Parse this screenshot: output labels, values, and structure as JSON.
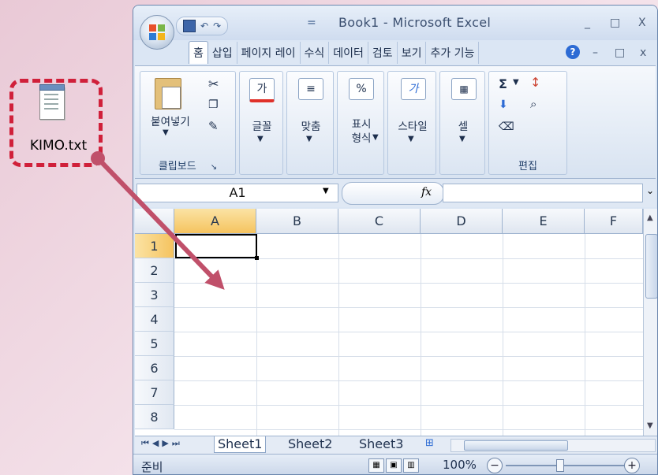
{
  "desktop": {
    "file_name": "KIMO.txt"
  },
  "window": {
    "title": "Book1 - Microsoft Excel",
    "controls": [
      "_",
      "□",
      "X"
    ]
  },
  "quick_access": {
    "undo": "↶",
    "redo": "↷",
    "more": "="
  },
  "ribbon": {
    "tabs": [
      "홈",
      "삽입",
      "페이지 레이",
      "수식",
      "데이터",
      "검토",
      "보기",
      "추가 기능"
    ],
    "groups": {
      "clipboard": {
        "label": "클립보드",
        "paste": "붙여넣기"
      },
      "font": {
        "label": "글꼴",
        "icon_text": "가"
      },
      "alignment": {
        "label": "맞춤"
      },
      "number": {
        "label": "표시\n형식",
        "icon_text": "%"
      },
      "styles": {
        "label": "스타일",
        "icon_text": "가"
      },
      "cells": {
        "label": "셀"
      },
      "editing": {
        "label": "편집",
        "sigma": "Σ"
      }
    }
  },
  "formula_bar": {
    "name_box": "A1",
    "fx": "fx",
    "value": ""
  },
  "sheet": {
    "columns": [
      "A",
      "B",
      "C",
      "D",
      "E",
      "F"
    ],
    "rows": [
      "1",
      "2",
      "3",
      "4",
      "5",
      "6",
      "7",
      "8"
    ],
    "active_cell": "A1"
  },
  "sheet_tabs": [
    "Sheet1",
    "Sheet2",
    "Sheet3"
  ],
  "status": {
    "mode": "준비",
    "zoom": "100%"
  },
  "colors": {
    "highlight": "#d0203a",
    "selected_header": "#f5c35f"
  }
}
